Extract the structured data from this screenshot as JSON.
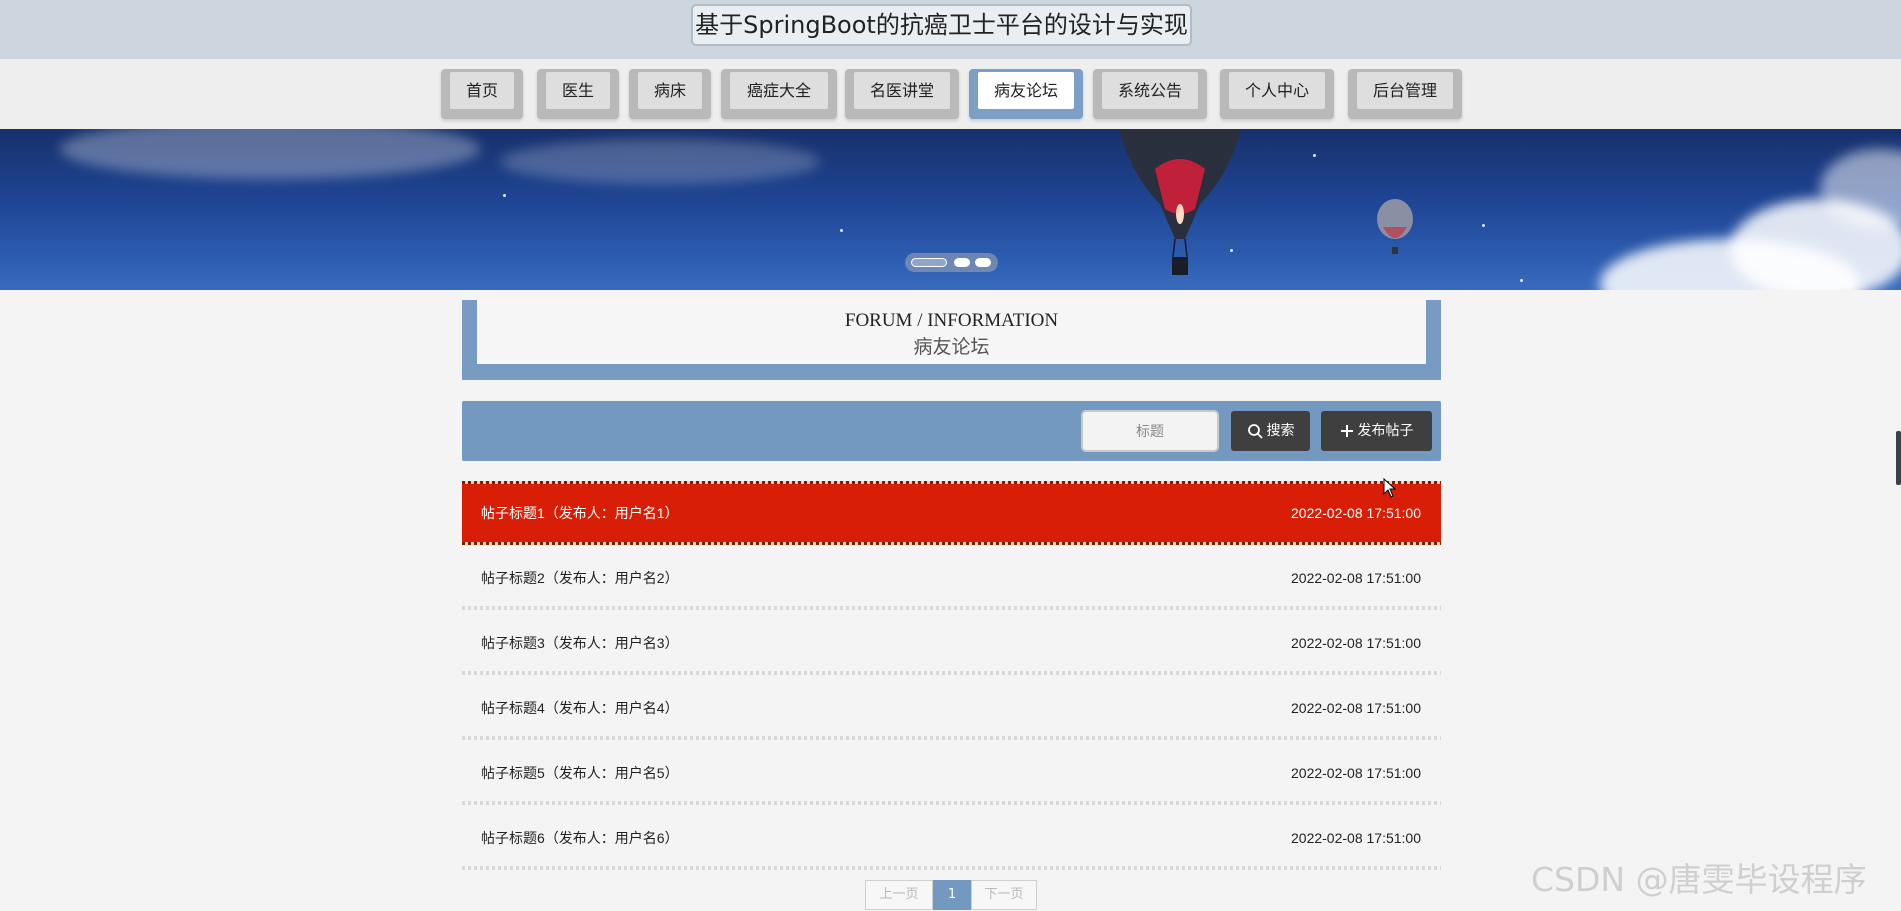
{
  "header": {
    "title": "基于SpringBoot的抗癌卫士平台的设计与实现"
  },
  "nav": {
    "items": [
      {
        "label": "首页"
      },
      {
        "label": "医生"
      },
      {
        "label": "病床"
      },
      {
        "label": "癌症大全"
      },
      {
        "label": "名医讲堂"
      },
      {
        "label": "病友论坛",
        "active": true
      },
      {
        "label": "系统公告"
      },
      {
        "label": "个人中心"
      },
      {
        "label": "后台管理"
      }
    ]
  },
  "banner": {
    "slide_count": 3,
    "active_slide": 1
  },
  "section": {
    "title_en": "FORUM / INFORMATION",
    "title_cn": "病友论坛"
  },
  "search": {
    "placeholder": "标题",
    "search_label": "搜索",
    "post_label": "发布帖子"
  },
  "posts": [
    {
      "title": "帖子标题1（发布人：用户名1）",
      "date": "2022-02-08 17:51:00",
      "highlighted": true
    },
    {
      "title": "帖子标题2（发布人：用户名2）",
      "date": "2022-02-08 17:51:00"
    },
    {
      "title": "帖子标题3（发布人：用户名3）",
      "date": "2022-02-08 17:51:00"
    },
    {
      "title": "帖子标题4（发布人：用户名4）",
      "date": "2022-02-08 17:51:00"
    },
    {
      "title": "帖子标题5（发布人：用户名5）",
      "date": "2022-02-08 17:51:00"
    },
    {
      "title": "帖子标题6（发布人：用户名6）",
      "date": "2022-02-08 17:51:00"
    }
  ],
  "pagination": {
    "prev_label": "上一页",
    "current_page": "1",
    "next_label": "下一页"
  },
  "watermark": {
    "text": "CSDN @唐雯毕设程序"
  },
  "colors": {
    "accent": "#7499c1",
    "highlight": "#d81e06",
    "dark_button": "#3f3f3f"
  }
}
